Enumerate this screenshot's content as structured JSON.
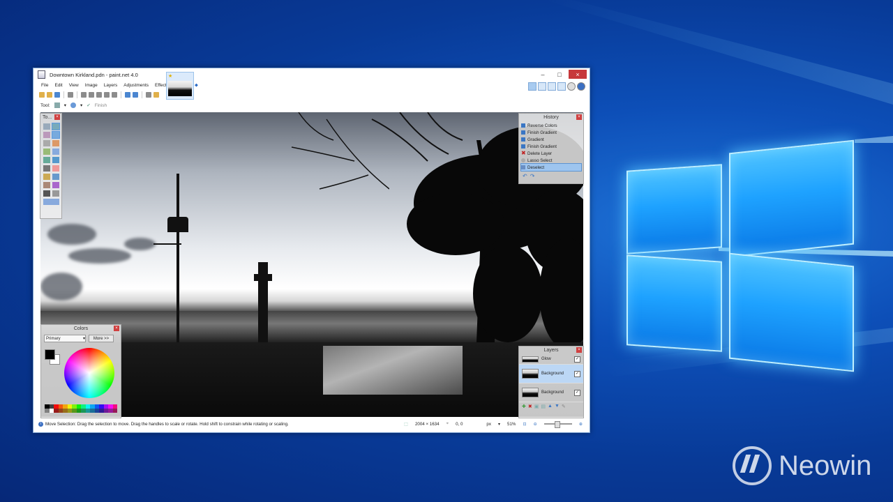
{
  "colors": {
    "desktop": "#0b4aa8",
    "accent": "#1ea2ff",
    "close_red": "#c7383b"
  },
  "branding": {
    "watermark": "Neowin"
  },
  "window": {
    "title": "Downtown Kirkland.pdn - paint.net 4.0",
    "controls": {
      "minimize": "–",
      "maximize": "□",
      "close": "×"
    },
    "menu": [
      "File",
      "Edit",
      "View",
      "Image",
      "Layers",
      "Adjustments",
      "Effects"
    ],
    "toolbar2": {
      "tool_label": "Tool:",
      "finish_label": "Finish"
    }
  },
  "tools_panel": {
    "title": "To..."
  },
  "history_panel": {
    "title": "History",
    "items": [
      {
        "label": "Reverse Colors",
        "icon": "effect-icon"
      },
      {
        "label": "Finish Gradient",
        "icon": "gradient-icon"
      },
      {
        "label": "Gradient",
        "icon": "gradient-icon"
      },
      {
        "label": "Finish Gradient",
        "icon": "gradient-icon"
      },
      {
        "label": "Delete Layer",
        "icon": "delete-icon"
      },
      {
        "label": "Lasso Select",
        "icon": "lasso-icon"
      },
      {
        "label": "Deselect",
        "icon": "deselect-icon",
        "selected": true
      }
    ]
  },
  "colors_panel": {
    "title": "Colors",
    "mode": "Primary",
    "more_button": "More >>",
    "primary": "#000000",
    "secondary": "#ffffff"
  },
  "layers_panel": {
    "title": "Layers",
    "layers": [
      {
        "name": "Glow",
        "visible": true
      },
      {
        "name": "Background",
        "visible": true,
        "selected": true
      },
      {
        "name": "Background",
        "visible": true
      }
    ]
  },
  "statusbar": {
    "hint": "Move Selection: Drag the selection to move. Drag the handles to scale or rotate. Hold shift to constrain while rotating or scaling.",
    "image_size": "2004 × 1634",
    "cursor_pos": "0, 0",
    "units": "px",
    "zoom": "51%"
  }
}
